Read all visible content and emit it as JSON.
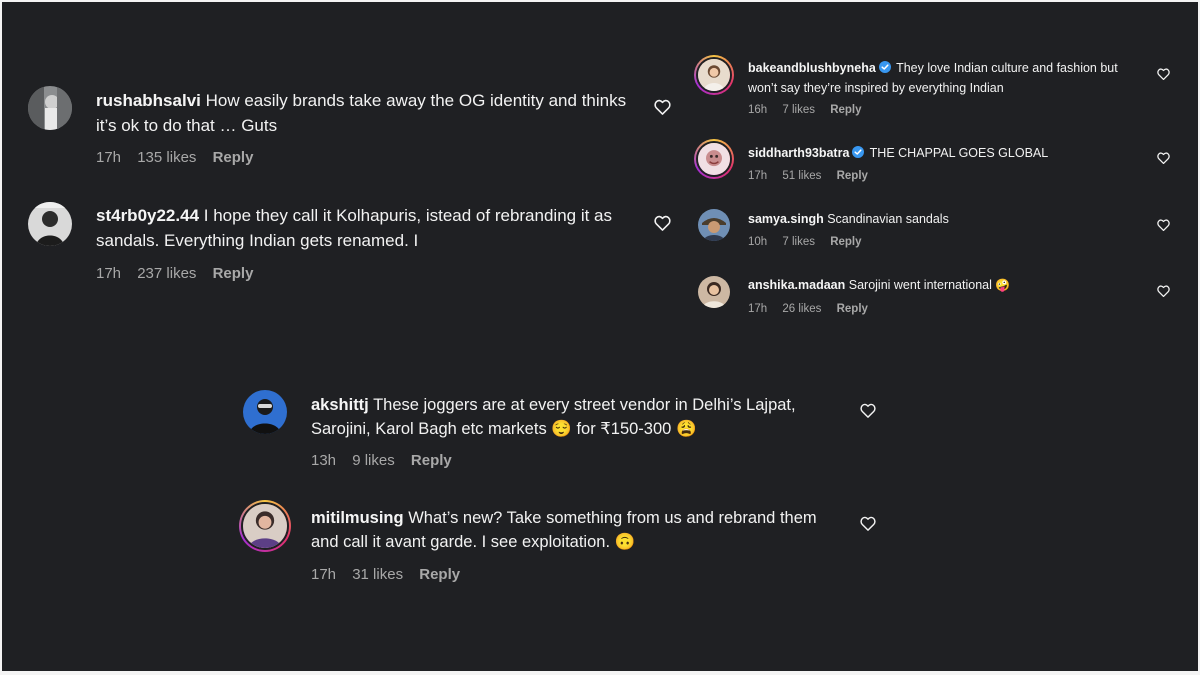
{
  "comments_left": [
    {
      "username": "rushabhsalvi",
      "text": "How easily brands take away the OG identity and thinks it’s ok to do that … Guts",
      "time": "17h",
      "likes": "135 likes",
      "reply": "Reply"
    },
    {
      "username": "st4rb0y22.44",
      "text": "I hope they call it Kolhapuris, istead of rebranding it as sandals. Everything Indian gets renamed. I",
      "time": "17h",
      "likes": "237 likes",
      "reply": "Reply"
    }
  ],
  "comments_right": [
    {
      "username": "bakeandblushbyneha",
      "verified": true,
      "text": "They love Indian culture and fashion but won’t say they’re inspired by everything Indian",
      "time": "16h",
      "likes": "7 likes",
      "reply": "Reply"
    },
    {
      "username": "siddharth93batra",
      "verified": true,
      "text": "THE CHAPPAL GOES GLOBAL",
      "time": "17h",
      "likes": "51 likes",
      "reply": "Reply"
    },
    {
      "username": "samya.singh",
      "verified": false,
      "text": "Scandinavian sandals",
      "time": "10h",
      "likes": "7 likes",
      "reply": "Reply"
    },
    {
      "username": "anshika.madaan",
      "verified": false,
      "text": "Sarojini went international",
      "emoji": "🤪",
      "time": "17h",
      "likes": "26 likes",
      "reply": "Reply"
    }
  ],
  "comments_bottom": [
    {
      "username": "akshittj",
      "text_part1": "These joggers are at every street vendor in Delhi’s Lajpat, Sarojini, Karol Bagh etc markets",
      "emoji1": "😌",
      "text_part2": "for ₹150-300",
      "emoji2": "😩",
      "time": "13h",
      "likes": "9 likes",
      "reply": "Reply"
    },
    {
      "username": "mitilmusing",
      "text": "What’s new? Take something from us and rebrand them and call it avant garde. I see exploitation.",
      "emoji": "🙃",
      "time": "17h",
      "likes": "31 likes",
      "reply": "Reply"
    }
  ],
  "icons": {
    "like": "heart-outline-icon",
    "verified": "verified-badge-icon"
  },
  "colors": {
    "background": "#1f2023",
    "text": "#f2f2f2",
    "meta": "#a8a8a8",
    "verified": "#3897f0"
  }
}
